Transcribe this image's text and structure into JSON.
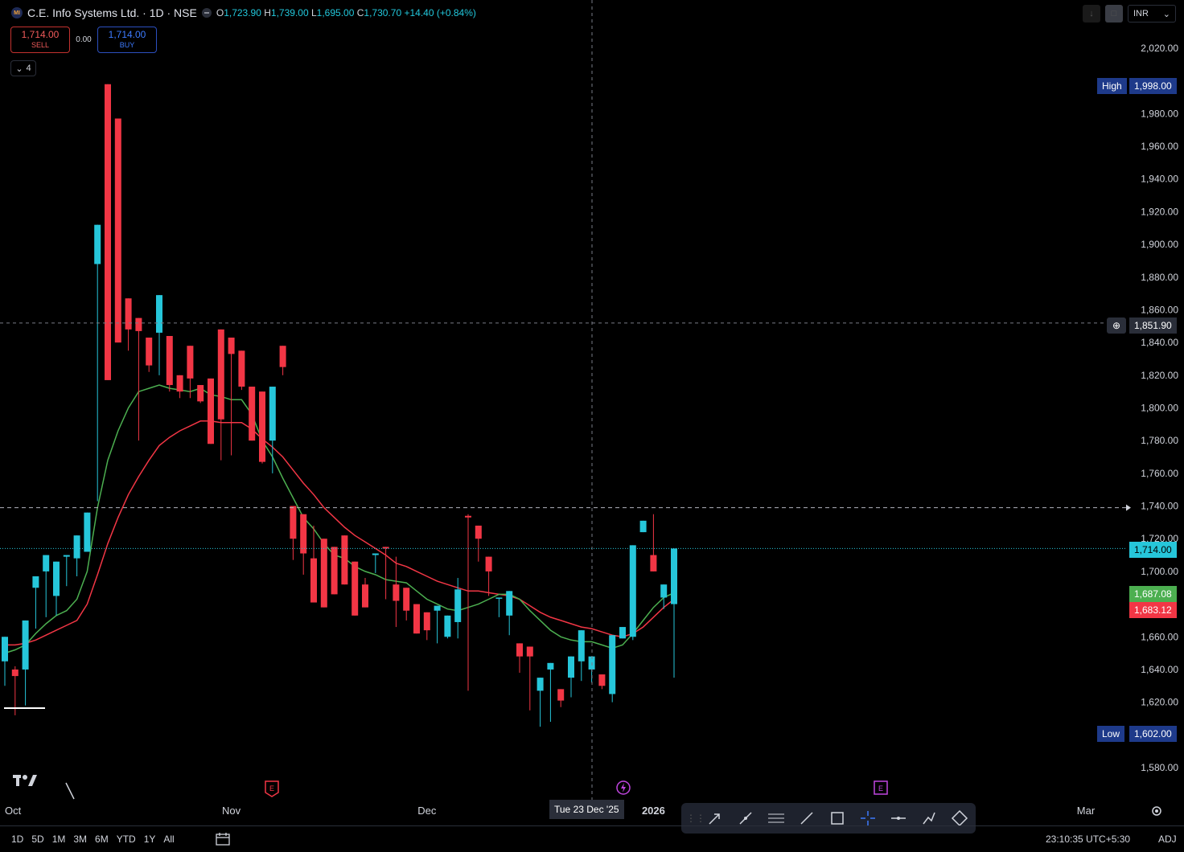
{
  "header": {
    "symbol_title": "C.E. Info Systems Ltd. · 1D · NSE",
    "logo_text": "MI",
    "ohlc": {
      "o_label": "O",
      "o": "1,723.90",
      "h_label": "H",
      "h": "1,739.00",
      "l_label": "L",
      "l": "1,695.00",
      "c_label": "C",
      "c": "1,730.70",
      "change": "+14.40 (+0.84%)"
    }
  },
  "trade": {
    "sell_price": "1,714.00",
    "sell_label": "SELL",
    "spread": "0.00",
    "buy_price": "1,714.00",
    "buy_label": "BUY"
  },
  "indicators_count": "4",
  "currency": "INR",
  "price_tags": {
    "high_label": "High",
    "high_value": "1,998.00",
    "low_label": "Low",
    "low_value": "1,602.00",
    "crosshair_price": "1,851.90",
    "last_price": "1,714.00",
    "ma_green": "1,687.08",
    "ma_red": "1,683.12"
  },
  "crosshair_date": "Tue 23 Dec '25",
  "colors": {
    "up": "#26c6da",
    "down": "#f23645",
    "ma_fast": "#4caf50",
    "ma_slow": "#f23645",
    "bg": "#000000",
    "grid": "#1a1a1a"
  },
  "bottom": {
    "ranges": [
      "1D",
      "5D",
      "1M",
      "3M",
      "6M",
      "YTD",
      "1Y",
      "All"
    ],
    "clock": "23:10:35 UTC+5:30",
    "adj": "ADJ"
  },
  "drawing_tools": [
    "arrow-tool-icon",
    "trend-line-icon",
    "horizontal-lines-icon",
    "line-icon",
    "rectangle-icon",
    "crosshair-icon",
    "horizontal-ray-icon",
    "path-icon",
    "polygon-icon"
  ],
  "chart_data": {
    "type": "candlestick",
    "y_ticks": [
      2020,
      1980,
      1960,
      1940,
      1920,
      1900,
      1880,
      1860,
      1840,
      1820,
      1800,
      1780,
      1760,
      1740,
      1720,
      1700,
      1660,
      1640,
      1620,
      1580
    ],
    "ylim": [
      1571,
      2042
    ],
    "x_labels": [
      "Oct",
      "Nov",
      "Dec",
      "2026",
      "Mar"
    ],
    "candles": [
      {
        "o": 1645,
        "h": 1650,
        "l": 1630,
        "c": 1660
      },
      {
        "o": 1640,
        "h": 1642,
        "l": 1612,
        "c": 1636
      },
      {
        "o": 1640,
        "h": 1628,
        "l": 1618,
        "c": 1670
      },
      {
        "o": 1690,
        "h": 1668,
        "l": 1665,
        "c": 1697
      },
      {
        "o": 1700,
        "h": 1684,
        "l": 1672,
        "c": 1710
      },
      {
        "o": 1685,
        "h": 1674,
        "l": 1673,
        "c": 1706
      },
      {
        "o": 1709,
        "h": 1693,
        "l": 1691,
        "c": 1710
      },
      {
        "o": 1708,
        "h": 1694,
        "l": 1697,
        "c": 1722
      },
      {
        "o": 1712,
        "h": 1736,
        "l": 1748,
        "c": 1736
      },
      {
        "o": 1888,
        "h": 1719,
        "l": 1743,
        "c": 1912
      },
      {
        "o": 1998,
        "h": 1785,
        "l": 1878,
        "c": 1817
      },
      {
        "o": 1977,
        "h": 1866,
        "l": 1857,
        "c": 1840
      },
      {
        "o": 1867,
        "h": 1851,
        "l": 1835,
        "c": 1848
      },
      {
        "o": 1855,
        "h": 1844,
        "l": 1780,
        "c": 1847
      },
      {
        "o": 1843,
        "h": 1837,
        "l": 1822,
        "c": 1826
      },
      {
        "o": 1846,
        "h": 1835,
        "l": 1820,
        "c": 1869
      },
      {
        "o": 1844,
        "h": 1843,
        "l": 1810,
        "c": 1814
      },
      {
        "o": 1820,
        "h": 1817,
        "l": 1806,
        "c": 1810
      },
      {
        "o": 1838,
        "h": 1828,
        "l": 1806,
        "c": 1818
      },
      {
        "o": 1814,
        "h": 1811,
        "l": 1803,
        "c": 1804
      },
      {
        "o": 1818,
        "h": 1811,
        "l": 1778,
        "c": 1778
      },
      {
        "o": 1848,
        "h": 1830,
        "l": 1768,
        "c": 1793
      },
      {
        "o": 1843,
        "h": 1828,
        "l": 1771,
        "c": 1833
      },
      {
        "o": 1835,
        "h": 1823,
        "l": 1811,
        "c": 1813
      },
      {
        "o": 1813,
        "h": 1801,
        "l": 1790,
        "c": 1780
      },
      {
        "o": 1810,
        "h": 1798,
        "l": 1766,
        "c": 1767
      },
      {
        "o": 1780,
        "h": 1783,
        "l": 1760,
        "c": 1813
      },
      {
        "o": 1838,
        "h": 1826,
        "l": 1820,
        "c": 1825
      },
      {
        "o": 1740,
        "h": 1722,
        "l": 1707,
        "c": 1720
      },
      {
        "o": 1735,
        "h": 1732,
        "l": 1698,
        "c": 1711
      },
      {
        "o": 1708,
        "h": 1728,
        "l": 1718,
        "c": 1681
      },
      {
        "o": 1720,
        "h": 1696,
        "l": 1681,
        "c": 1678
      },
      {
        "o": 1715,
        "h": 1697,
        "l": 1692,
        "c": 1686
      },
      {
        "o": 1722,
        "h": 1705,
        "l": 1694,
        "c": 1692
      },
      {
        "o": 1706,
        "h": 1696,
        "l": 1688,
        "c": 1673
      },
      {
        "o": 1692,
        "h": 1696,
        "l": 1687,
        "c": 1678
      },
      {
        "o": 1710,
        "h": 1704,
        "l": 1699,
        "c": 1711
      },
      {
        "o": 1715,
        "h": 1697,
        "l": 1683,
        "c": 1714
      },
      {
        "o": 1692,
        "h": 1709,
        "l": 1666,
        "c": 1682
      },
      {
        "o": 1690,
        "h": 1687,
        "l": 1670,
        "c": 1676
      },
      {
        "o": 1680,
        "h": 1671,
        "l": 1662,
        "c": 1662
      },
      {
        "o": 1675,
        "h": 1675,
        "l": 1658,
        "c": 1664
      },
      {
        "o": 1676,
        "h": 1663,
        "l": 1656,
        "c": 1679
      },
      {
        "o": 1660,
        "h": 1651,
        "l": 1659,
        "c": 1673
      },
      {
        "o": 1669,
        "h": 1696,
        "l": 1659,
        "c": 1689
      },
      {
        "o": 1734,
        "h": 1735,
        "l": 1627,
        "c": 1733
      },
      {
        "o": 1728,
        "h": 1715,
        "l": 1706,
        "c": 1720
      },
      {
        "o": 1709,
        "h": 1705,
        "l": 1685,
        "c": 1700
      },
      {
        "o": 1684,
        "h": 1681,
        "l": 1672,
        "c": 1684
      },
      {
        "o": 1673,
        "h": 1666,
        "l": 1661,
        "c": 1688
      },
      {
        "o": 1656,
        "h": 1647,
        "l": 1638,
        "c": 1648
      },
      {
        "o": 1654,
        "h": 1648,
        "l": 1615,
        "c": 1648
      },
      {
        "o": 1627,
        "h": 1612,
        "l": 1605,
        "c": 1635
      },
      {
        "o": 1640,
        "h": 1627,
        "l": 1608,
        "c": 1644
      },
      {
        "o": 1628,
        "h": 1625,
        "l": 1617,
        "c": 1621
      },
      {
        "o": 1635,
        "h": 1631,
        "l": 1623,
        "c": 1648
      },
      {
        "o": 1645,
        "h": 1660,
        "l": 1633,
        "c": 1664
      },
      {
        "o": 1640,
        "h": 1640,
        "l": 1632,
        "c": 1648
      },
      {
        "o": 1637,
        "h": 1621,
        "l": 1628,
        "c": 1630
      },
      {
        "o": 1625,
        "h": 1623,
        "l": 1620,
        "c": 1661
      },
      {
        "o": 1659,
        "h": 1645,
        "l": 1660,
        "c": 1666
      },
      {
        "o": 1660,
        "h": 1646,
        "l": 1658,
        "c": 1716
      },
      {
        "o": 1724,
        "h": 1710,
        "l": 1724,
        "c": 1731
      },
      {
        "o": 1710,
        "h": 1735,
        "l": 1700,
        "c": 1700
      },
      {
        "o": 1684,
        "h": 1684,
        "l": 1677,
        "c": 1692
      },
      {
        "o": 1680,
        "h": 1691,
        "l": 1635,
        "c": 1714
      }
    ],
    "ma_fast": [
      1650,
      1652,
      1655,
      1662,
      1668,
      1673,
      1676,
      1683,
      1700,
      1739,
      1768,
      1786,
      1800,
      1810,
      1812,
      1814,
      1812,
      1811,
      1810,
      1812,
      1808,
      1807,
      1805,
      1805,
      1796,
      1780,
      1770,
      1757,
      1745,
      1733,
      1726,
      1717,
      1710,
      1708,
      1703,
      1700,
      1698,
      1695,
      1694,
      1693,
      1688,
      1683,
      1680,
      1677,
      1676,
      1678,
      1680,
      1683,
      1686,
      1686,
      1683,
      1676,
      1670,
      1664,
      1660,
      1658,
      1657,
      1657,
      1655,
      1653,
      1655,
      1662,
      1670,
      1678,
      1684,
      1687
    ],
    "ma_slow": [
      1655,
      1655,
      1656,
      1658,
      1661,
      1664,
      1667,
      1670,
      1680,
      1698,
      1717,
      1733,
      1747,
      1758,
      1768,
      1777,
      1782,
      1786,
      1789,
      1792,
      1792,
      1791,
      1791,
      1791,
      1787,
      1781,
      1776,
      1770,
      1762,
      1754,
      1747,
      1739,
      1733,
      1727,
      1722,
      1718,
      1714,
      1710,
      1705,
      1703,
      1700,
      1697,
      1694,
      1692,
      1690,
      1688,
      1688,
      1687,
      1686,
      1685,
      1683,
      1679,
      1675,
      1672,
      1670,
      1668,
      1666,
      1665,
      1663,
      1661,
      1660,
      1662,
      1666,
      1672,
      1678,
      1683
    ]
  }
}
